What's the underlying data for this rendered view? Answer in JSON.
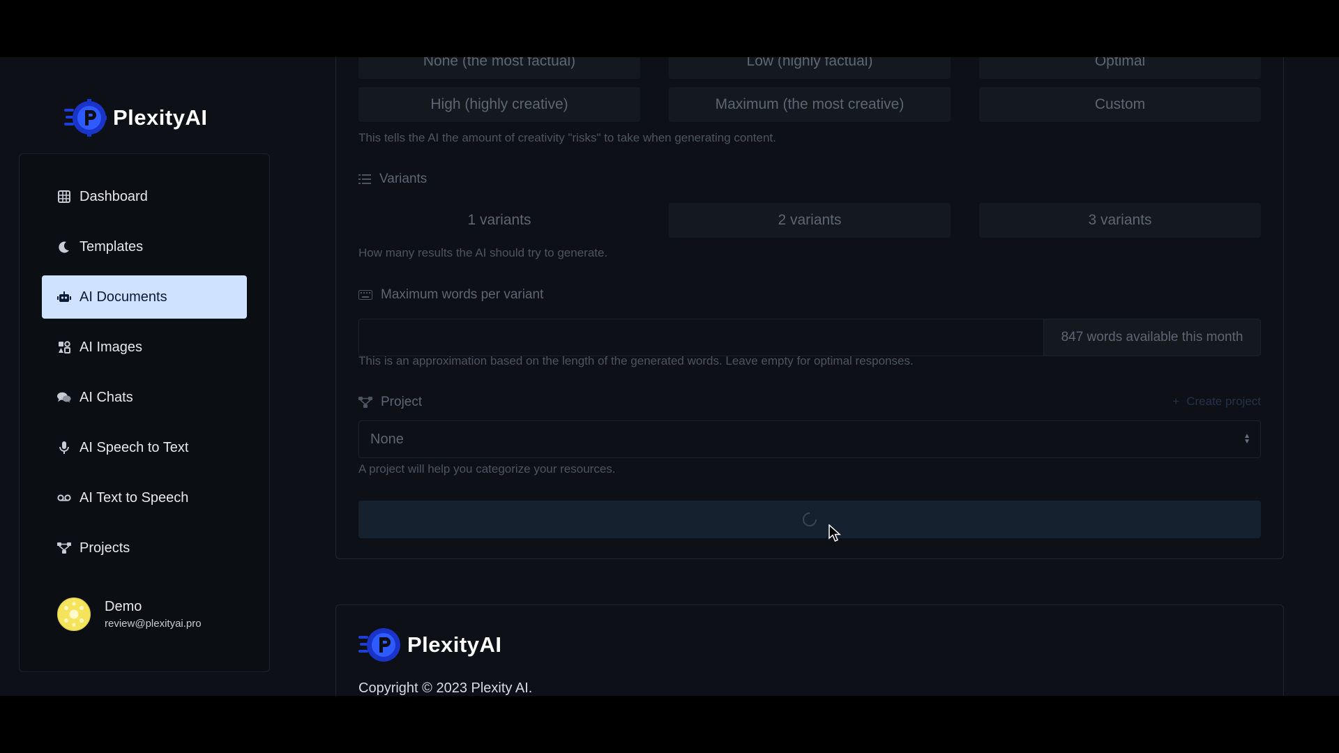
{
  "brand": {
    "name": "PlexityAI"
  },
  "sidebar": {
    "items": [
      {
        "label": "Dashboard",
        "icon": "grid-icon"
      },
      {
        "label": "Templates",
        "icon": "moon-icon"
      },
      {
        "label": "AI Documents",
        "icon": "robot-icon",
        "active": true
      },
      {
        "label": "AI Images",
        "icon": "images-icon"
      },
      {
        "label": "AI Chats",
        "icon": "chats-icon"
      },
      {
        "label": "AI Speech to Text",
        "icon": "microphone-icon"
      },
      {
        "label": "AI Text to Speech",
        "icon": "voicemail-icon"
      },
      {
        "label": "Projects",
        "icon": "projects-icon"
      }
    ],
    "user": {
      "name": "Demo",
      "email": "review@plexityai.pro"
    }
  },
  "creativity": {
    "row1": [
      "None (the most factual)",
      "Low (highly factual)",
      "Optimal"
    ],
    "row2": [
      "High (highly creative)",
      "Maximum (the most creative)",
      "Custom"
    ],
    "help": "This tells the AI the amount of creativity \"risks\" to take when generating content."
  },
  "variants": {
    "label": "Variants",
    "options": [
      "1 variants",
      "2 variants",
      "3 variants"
    ],
    "help": "How many results the AI should try to generate."
  },
  "max_words": {
    "label": "Maximum words per variant",
    "value": "",
    "suffix": "847 words available this month",
    "help": "This is an approximation based on the length of the generated words. Leave empty for optimal responses."
  },
  "project": {
    "label": "Project",
    "create_label": "Create project",
    "selected": "None",
    "help": "A project will help you categorize your resources."
  },
  "footer": {
    "copyright": "Copyright © 2023 Plexity AI."
  },
  "colors": {
    "active_nav_bg": "#cfe2ff",
    "page_bg": "#0d1117",
    "submit_bg": "#162130"
  }
}
